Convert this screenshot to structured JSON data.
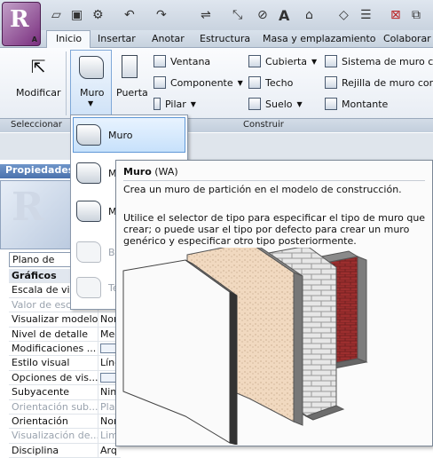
{
  "app": {
    "logo_letter": "R",
    "logo_sub": "A"
  },
  "tabs": [
    {
      "label": "Inicio",
      "active": true
    },
    {
      "label": "Insertar"
    },
    {
      "label": "Anotar"
    },
    {
      "label": "Estructura"
    },
    {
      "label": "Masa y emplazamiento"
    },
    {
      "label": "Colaborar"
    }
  ],
  "ribbon": {
    "modificar": "Modificar",
    "muro": "Muro",
    "puerta": "Puerta",
    "ventana": "Ventana",
    "componente": "Componente",
    "pilar": "Pilar",
    "cubierta": "Cubierta",
    "techo": "Techo",
    "suelo": "Suelo",
    "sistema_muro": "Sistema de muro co",
    "rejilla_muro": "Rejilla de muro corti",
    "montante": "Montante",
    "panel_seleccionar": "Seleccionar",
    "panel_construir": "Construir"
  },
  "dropdown": {
    "items": [
      {
        "label": "Muro",
        "selected": true
      },
      {
        "label": "M"
      },
      {
        "label": "M"
      },
      {
        "label": "B",
        "disabled": true
      },
      {
        "label": "Te",
        "disabled": true
      }
    ]
  },
  "properties": {
    "header": "Propiedades",
    "type_selector": "Plano de pla",
    "rows": [
      {
        "name": "Gráficos",
        "value": "",
        "category": true
      },
      {
        "name": "Escala de vis",
        "value": ""
      },
      {
        "name": "Valor de esc",
        "value": "",
        "disabled": true
      },
      {
        "name": "Visualizar modelo",
        "value": "Nor"
      },
      {
        "name": "Nivel de detalle",
        "value": "Med"
      },
      {
        "name": "Modificaciones ...",
        "value": "",
        "checkbox": true
      },
      {
        "name": "Estilo visual",
        "value": "Líne"
      },
      {
        "name": "Opciones de vis...",
        "value": "",
        "checkbox": true
      },
      {
        "name": "Subyacente",
        "value": "Ning"
      },
      {
        "name": "Orientación sub...",
        "value": "Plan",
        "disabled": true
      },
      {
        "name": "Orientación",
        "value": "Nor"
      },
      {
        "name": "Visualización de...",
        "value": "Limp",
        "disabled": true
      },
      {
        "name": "Disciplina",
        "value": "Arq"
      }
    ]
  },
  "tooltip": {
    "title": "Muro",
    "title_suffix": " (WA)",
    "description": "Crea un muro de partición en el modelo de construcción.",
    "long_text": "Utilice el selector de tipo para especificar el tipo de muro que crear; o puede usar el tipo por defecto para crear un muro genérico y especificar otro tipo posteriormente."
  },
  "colors": {
    "accent": "#5f97d6",
    "brick": "#9c2e2e",
    "header": "#4b72ad"
  }
}
